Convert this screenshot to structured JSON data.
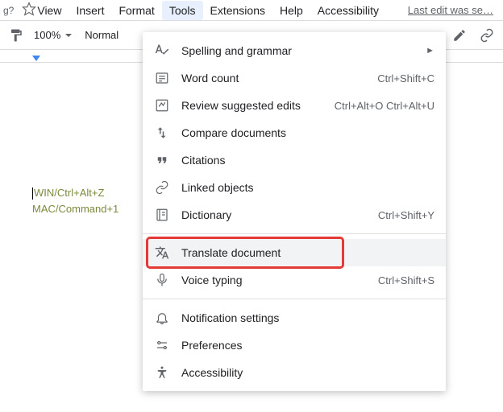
{
  "topbar": {
    "title_frag": "g?",
    "menus": [
      "View",
      "Insert",
      "Format",
      "Tools",
      "Extensions",
      "Help",
      "Accessibility"
    ],
    "active_index": 3,
    "last_edit": "Last edit was se…"
  },
  "toolbar": {
    "zoom": "100%",
    "style": "Normal"
  },
  "doc": {
    "line1": "WIN/Ctrl+Alt+Z",
    "line2": "MAC/Command+1"
  },
  "dropdown": {
    "items": [
      {
        "label": "Spelling and grammar",
        "icon": "spellcheck",
        "submenu": true
      },
      {
        "label": "Word count",
        "icon": "wordcount",
        "shortcut": "Ctrl+Shift+C"
      },
      {
        "label": "Review suggested edits",
        "icon": "review",
        "shortcut": "Ctrl+Alt+O Ctrl+Alt+U"
      },
      {
        "label": "Compare documents",
        "icon": "compare"
      },
      {
        "label": "Citations",
        "icon": "citations"
      },
      {
        "label": "Linked objects",
        "icon": "linked"
      },
      {
        "label": "Dictionary",
        "icon": "dictionary",
        "shortcut": "Ctrl+Shift+Y"
      },
      {
        "divider": true
      },
      {
        "label": "Translate document",
        "icon": "translate",
        "highlighted": true,
        "boxed": true
      },
      {
        "label": "Voice typing",
        "icon": "voice",
        "shortcut": "Ctrl+Shift+S"
      },
      {
        "divider": true
      },
      {
        "label": "Notification settings",
        "icon": "bell"
      },
      {
        "label": "Preferences",
        "icon": "prefs"
      },
      {
        "label": "Accessibility",
        "icon": "accessibility"
      }
    ]
  }
}
